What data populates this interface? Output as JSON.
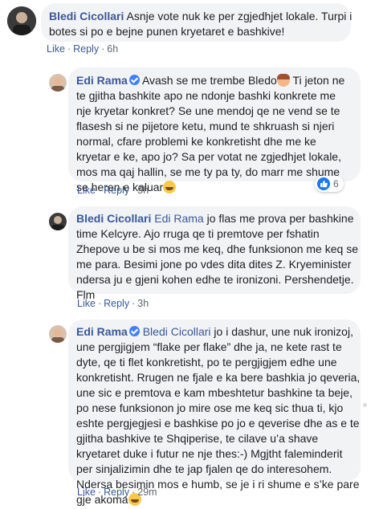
{
  "comments": [
    {
      "author": "Bledi Cicollari",
      "lines": [
        "Asnje vote nuk ke per zgjedhjet lokale. Turpi i",
        "botes si po e bejne punen kryetaret e bashkive!"
      ],
      "like": "Like",
      "reply": "Reply",
      "time": "6h"
    },
    {
      "author": "Edi Rama",
      "first_line": "Avash se me trembe Bledo",
      "first_line_tail": " Ti jeton ne",
      "lines": [
        "te gjitha bashkite apo ne ndonje bashki konkrete me",
        "nje kryetar konkret? Se une mendoj qe ne vend se te",
        "flasesh si ne pijetore ketu, mund te shkruash si njeri",
        "normal, cfare problemi ke konkretisht dhe me ke",
        "kryetar e ke, apo jo? Sa per votat ne zgjedhjet lokale,",
        "mos ma qaj hallin, se me ty pa ty, do marr me shume",
        "se heren e kaluar"
      ],
      "like": "Like",
      "reply": "Reply",
      "time": "5h",
      "reaction_count": "6"
    },
    {
      "author": "Bledi Cicollari",
      "mention": "Edi Rama",
      "first_line_tail": " jo flas me prova per bashkine",
      "lines": [
        "time Kelcyre. Ajo rruga qe ti premtove per fshatin",
        "Zhepove u be si mos me keq, dhe funksionon me keq se",
        "me para. Besimi jone po vdes dita dites Z. Kryeminister",
        "ndersa ju e gjeni kohen edhe te ironizoni. Pershendetje.",
        "Flm"
      ],
      "like": "Like",
      "reply": "Reply",
      "time": "3h"
    },
    {
      "author": "Edi Rama",
      "mention": "Bledi Cicollari",
      "first_line_tail": " jo i dashur, une nuk ironizoj,",
      "lines": [
        "une pergjigjem “flake per flake” dhe ja, ne kete rast te",
        "dyte, qe ti flet konkretisht, po te pergjigjem edhe une",
        "konkretisht. Rrugen ne fjale e ka bere bashkia jo qeveria,",
        "une sic e premtova e kam mbeshtetur bashkine ta beje,",
        "po nese funksionon jo mire ose me keq sic thua ti, kjo",
        "eshte pergjegjesi e bashkise po jo e qeverise dhe as e te",
        "gjitha bashkive te Shqiperise, te cilave u’a shave",
        "kryetaret duke i futur ne nje thes:-) Mgjtht faleminderit",
        "per sinjalizimin dhe te jap fjalen qe do interesohem.",
        "Ndersa besimin mos e humb, se je i ri shume e s’ke pare",
        "gje akoma"
      ],
      "like": "Like",
      "reply": "Reply",
      "time": "29m"
    }
  ]
}
